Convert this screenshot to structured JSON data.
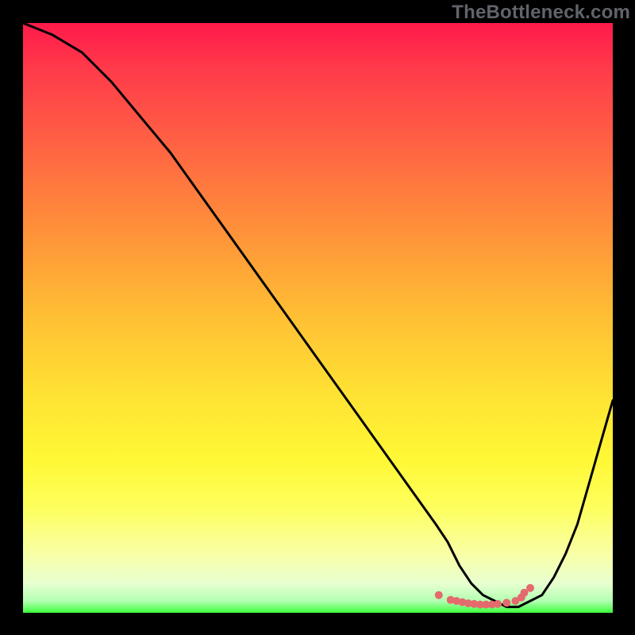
{
  "watermark": "TheBottleneck.com",
  "chart_data": {
    "type": "line",
    "title": "",
    "xlabel": "",
    "ylabel": "",
    "xlim": [
      0,
      100
    ],
    "ylim": [
      0,
      100
    ],
    "grid": false,
    "background": "red-yellow-green vertical gradient",
    "series": [
      {
        "name": "bottleneck-curve",
        "color": "#000000",
        "x": [
          0,
          5,
          10,
          15,
          20,
          25,
          30,
          35,
          40,
          45,
          50,
          55,
          60,
          65,
          70,
          72,
          74,
          76,
          78,
          80,
          82,
          84,
          86,
          88,
          90,
          92,
          94,
          96,
          98,
          100
        ],
        "values": [
          100,
          98,
          95,
          90,
          84,
          78,
          71,
          64,
          57,
          50,
          43,
          36,
          29,
          22,
          15,
          12,
          8,
          5,
          3,
          2,
          1,
          1,
          2,
          3,
          6,
          10,
          15,
          22,
          29,
          36
        ]
      }
    ],
    "markers": [
      {
        "name": "highlight-dots",
        "color": "#e46a6d",
        "radius": 5,
        "x": [
          70.5,
          72.5,
          73.5,
          74.5,
          75.5,
          76.5,
          77.5,
          78.5,
          79.5,
          80.5,
          82.0,
          83.5,
          84.5,
          85.0,
          86.0
        ],
        "values": [
          3.0,
          2.2,
          2.0,
          1.8,
          1.6,
          1.5,
          1.4,
          1.4,
          1.4,
          1.5,
          1.7,
          2.0,
          2.6,
          3.4,
          4.2
        ]
      }
    ]
  }
}
